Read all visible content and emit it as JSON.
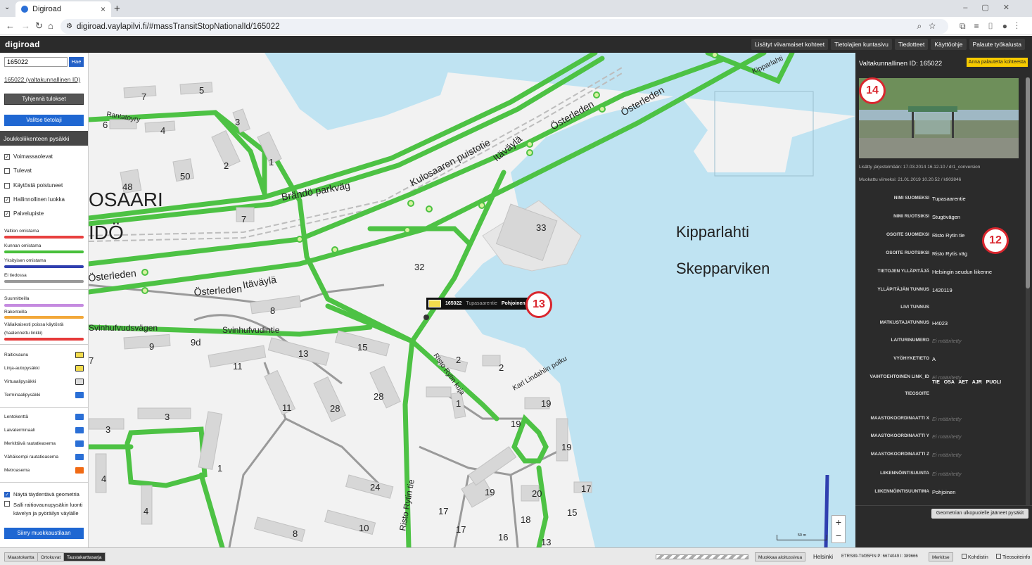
{
  "browser": {
    "tab_title": "Digiroad",
    "url": "digiroad.vaylapilvi.fi/#massTransitStopNationalId/165022"
  },
  "header": {
    "logo": "digiroad",
    "links": [
      "Lisätyt viivamaiset kohteet",
      "Tietolajien kuntasivu",
      "Tiedotteet",
      "Käyttöohje",
      "Palaute työkalusta"
    ]
  },
  "sidebar": {
    "search_value": "165022",
    "search_button": "Hae",
    "result_link": "165022 (valtakunnallinen ID)",
    "clear_button": "Tyhjennä tulokset",
    "choose_button": "Valitse tietolaji",
    "section_title": "Joukkoliikenteen pysäkki",
    "checkboxes": [
      {
        "label": "Voimassaolevat",
        "checked": true
      },
      {
        "label": "Tulevat",
        "checked": false
      },
      {
        "label": "Käytöstä poistuneet",
        "checked": false
      },
      {
        "label": "Hallinnollinen luokka",
        "checked": true
      },
      {
        "label": "Palvelupiste",
        "checked": true
      }
    ],
    "legend": [
      {
        "label": "Valtion omistama",
        "color": "#e8403f"
      },
      {
        "label": "Kunnan omistama",
        "color": "#48c03b"
      },
      {
        "label": "Yksityisen omistama",
        "color": "#2f3faf"
      },
      {
        "label": "Ei tiedossa",
        "color": "#999999"
      },
      {
        "label": "Suunnitteilla",
        "color": "#c58be0"
      },
      {
        "label": "Rakenteilla",
        "color": "#f2a83a"
      },
      {
        "label": "Väliaikaisesti poissa käytöstä",
        "color": "#e63a3a"
      },
      {
        "label": "(haalennettu linkki)",
        "color": ""
      }
    ],
    "stop_types": [
      "Raitiovaunu",
      "Linja-autopysäkki",
      "Virtuaalipysäkki",
      "Terminaalipysäkki"
    ],
    "service_points": [
      "Lentokenttä",
      "Laivaterminaali",
      "Merkittävä rautatieasema",
      "Vähäisempi rautatieasema",
      "Metroasema"
    ],
    "options": [
      {
        "label": "Näytä täydentävä geometria",
        "checked": true
      },
      {
        "label": "Salli raitiovaunupysäkin luonti kävelyn ja pyöräilyn väylälle",
        "checked": false
      }
    ],
    "edit_button": "Siirry muokkaustilaan"
  },
  "map": {
    "labels": {
      "water1": "Kipparlahti",
      "water2": "Skepparviken",
      "area1": "OSAARI",
      "area2": "IDÖ",
      "roads": [
        "Kulosaaren puistotie",
        "Brändö parkväg",
        "Österleden",
        "Itäväylä",
        "Svinhufvudintie",
        "Svinhufvudsvägen",
        "Risto Rytin tie",
        "Risto Rytin kuja",
        "Karl Lindahlin polku",
        "Rantatoyry",
        "Tupasaarentie",
        "Kipparlahti"
      ],
      "buildings": [
        "7",
        "5",
        "6",
        "4",
        "3",
        "2",
        "1",
        "48",
        "50",
        "7",
        "33",
        "32",
        "8",
        "9",
        "9d",
        "13",
        "15",
        "11",
        "2",
        "2",
        "1",
        "19",
        "11",
        "28",
        "28",
        "19",
        "3",
        "1",
        "4",
        "4",
        "24",
        "19",
        "20",
        "17",
        "17",
        "17",
        "18",
        "16",
        "13",
        "10",
        "8",
        "15",
        "19"
      ]
    },
    "tooltip": {
      "id": "165022",
      "name": "Tupasaarentie",
      "direction": "Pohjoinen"
    },
    "markers": [
      "13",
      "14",
      "12"
    ],
    "scale_label": "50 m",
    "zoom_in": "+",
    "zoom_out": "−"
  },
  "panel": {
    "title": "Valtakunnallinen ID: 165022",
    "feedback_button": "Anna palautetta kohteesta",
    "added": "Lisätty järjestelmään: 17.03.2014 16.12.10 / dr1_conversion",
    "modified": "Muokattu viimeksi: 21.01.2019 10.20.52 / k903846",
    "fields": [
      {
        "key": "Nimi suomeksi",
        "value": "Tupasaarentie"
      },
      {
        "key": "Nimi ruotsiksi",
        "value": "Stugövägen"
      },
      {
        "key": "Osoite suomeksi",
        "value": "Risto Rytin tie"
      },
      {
        "key": "Osoite ruotsiksi",
        "value": "Risto Rytis väg"
      },
      {
        "key": "Tietojen ylläpitäjä",
        "value": "Helsingin seudun liikenne"
      },
      {
        "key": "Ylläpitäjän tunnus",
        "value": "1420119"
      },
      {
        "key": "Livi tunnus",
        "value": ""
      },
      {
        "key": "Matkustajatunnus",
        "value": "H4023"
      },
      {
        "key": "Laiturinumero",
        "value": "Ei määritetty",
        "empty": true
      },
      {
        "key": "Vyöhyketieto",
        "value": "A"
      },
      {
        "key": "Vaihtoehtoinen link_id",
        "value": "Ei määritetty",
        "empty": true
      },
      {
        "key": "Tieosoite",
        "value": "TIE   OSA   AET   AJR   PUOLI"
      },
      {
        "key": "Maastokoordinaatti X",
        "value": "Ei määritetty",
        "empty": true
      },
      {
        "key": "Maastokoordinaatti Y",
        "value": "Ei määritetty",
        "empty": true
      },
      {
        "key": "Maastokoordinaatti Z",
        "value": "Ei määritetty",
        "empty": true
      },
      {
        "key": "Liikennöintisuunta",
        "value": "Ei määritetty",
        "empty": true
      },
      {
        "key": "Liikennöintisuuntima",
        "value": "Pohjoinen"
      }
    ],
    "geometry_button": "Geometrian ulkopuolelle jääneet pysäkit"
  },
  "footer": {
    "map_buttons": [
      "Maastokartta",
      "Ortokuvat",
      "Taustakarttasarja"
    ],
    "active_map": "Taustakarttasarja",
    "edit_period": "Muokkaa aloitussivua",
    "municipality": "Helsinki",
    "coords": "ETRS89-TM35FIN  P: 6674049  I: 389666",
    "move_button": "Merkitse",
    "target": "Kohdistin",
    "road_info": "Tieosoiteinfo"
  }
}
